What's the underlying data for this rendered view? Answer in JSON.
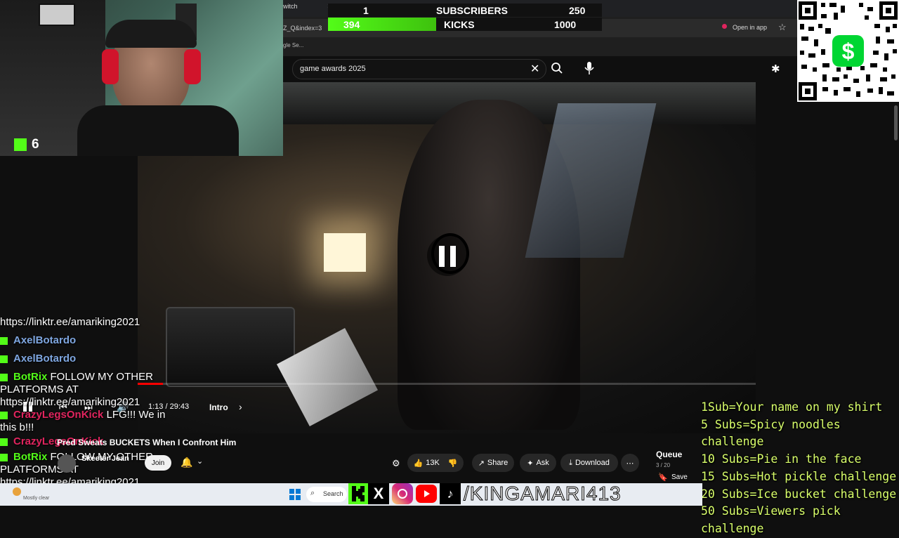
{
  "browser": {
    "tab_label": "witch",
    "tab_close": "×",
    "tab_add": "+",
    "address_fragment": "Z_Q&index=3",
    "open_in_app": "Open in app",
    "bookmark_fragment": "gle Se..."
  },
  "sub_goals": {
    "subs_current": "1",
    "subs_label": "SUBSCRIBERS",
    "subs_target": "250",
    "kicks_current": "394",
    "kicks_label": "KICKS",
    "kicks_target": "1000",
    "kicks_fraction": 0.394
  },
  "webcam": {
    "viewer_count": "6"
  },
  "youtube": {
    "search_value": "game awards 2025",
    "timecode": "1:13 / 29:43",
    "chapter": "Intro",
    "video_title": "Pred Sweats BUCKETS When I Confront Him",
    "channel": "Skeeter Jean",
    "join": "Join",
    "likes": "13K",
    "share": "Share",
    "ask": "Ask",
    "download": "Download",
    "queue_title": "Queue",
    "queue_count": "3 / 20",
    "save": "Save",
    "progress_fraction": 0.041
  },
  "chat": [
    {
      "user": "",
      "msg": "https://linktr.ee/amariking2021",
      "color": "#ffffff"
    },
    {
      "user": "AxelBotardo",
      "msg": "",
      "color": "#7ea6e0"
    },
    {
      "user": "AxelBotardo",
      "msg": "",
      "color": "#7ea6e0"
    },
    {
      "user": "BotRix",
      "msg": "FOLLOW MY OTHER PLATFORMS AT https://linktr.ee/amariking2021",
      "color": "#53fc18"
    },
    {
      "user": "CrazyLegsOnKick",
      "msg": "LFG!!! We in this b!!!",
      "color": "#e0245e"
    },
    {
      "user": "CrazyLegsOnKick",
      "msg": "",
      "color": "#e0245e"
    },
    {
      "user": "BotRix",
      "msg": "FOLLOW MY OTHER PLATFORMS AT https://linktr.ee/amariking2021",
      "color": "#53fc18"
    }
  ],
  "goals_list": [
    "1Sub=Your name on my shirt",
    "5 Subs=Spicy noodles challenge",
    "10 Subs=Pie in the face",
    "15 Subs=Hot pickle challenge",
    "20 Subs=Ice bucket challenge",
    "50 Subs=Viewers pick challenge"
  ],
  "taskbar": {
    "weather": "Mostly clear",
    "search_label": "Search",
    "handle": "/KINGAMARI413"
  },
  "colors": {
    "kick_green": "#53fc18",
    "goal_text": "#d9ff6b",
    "youtube_red": "#ff0000"
  }
}
